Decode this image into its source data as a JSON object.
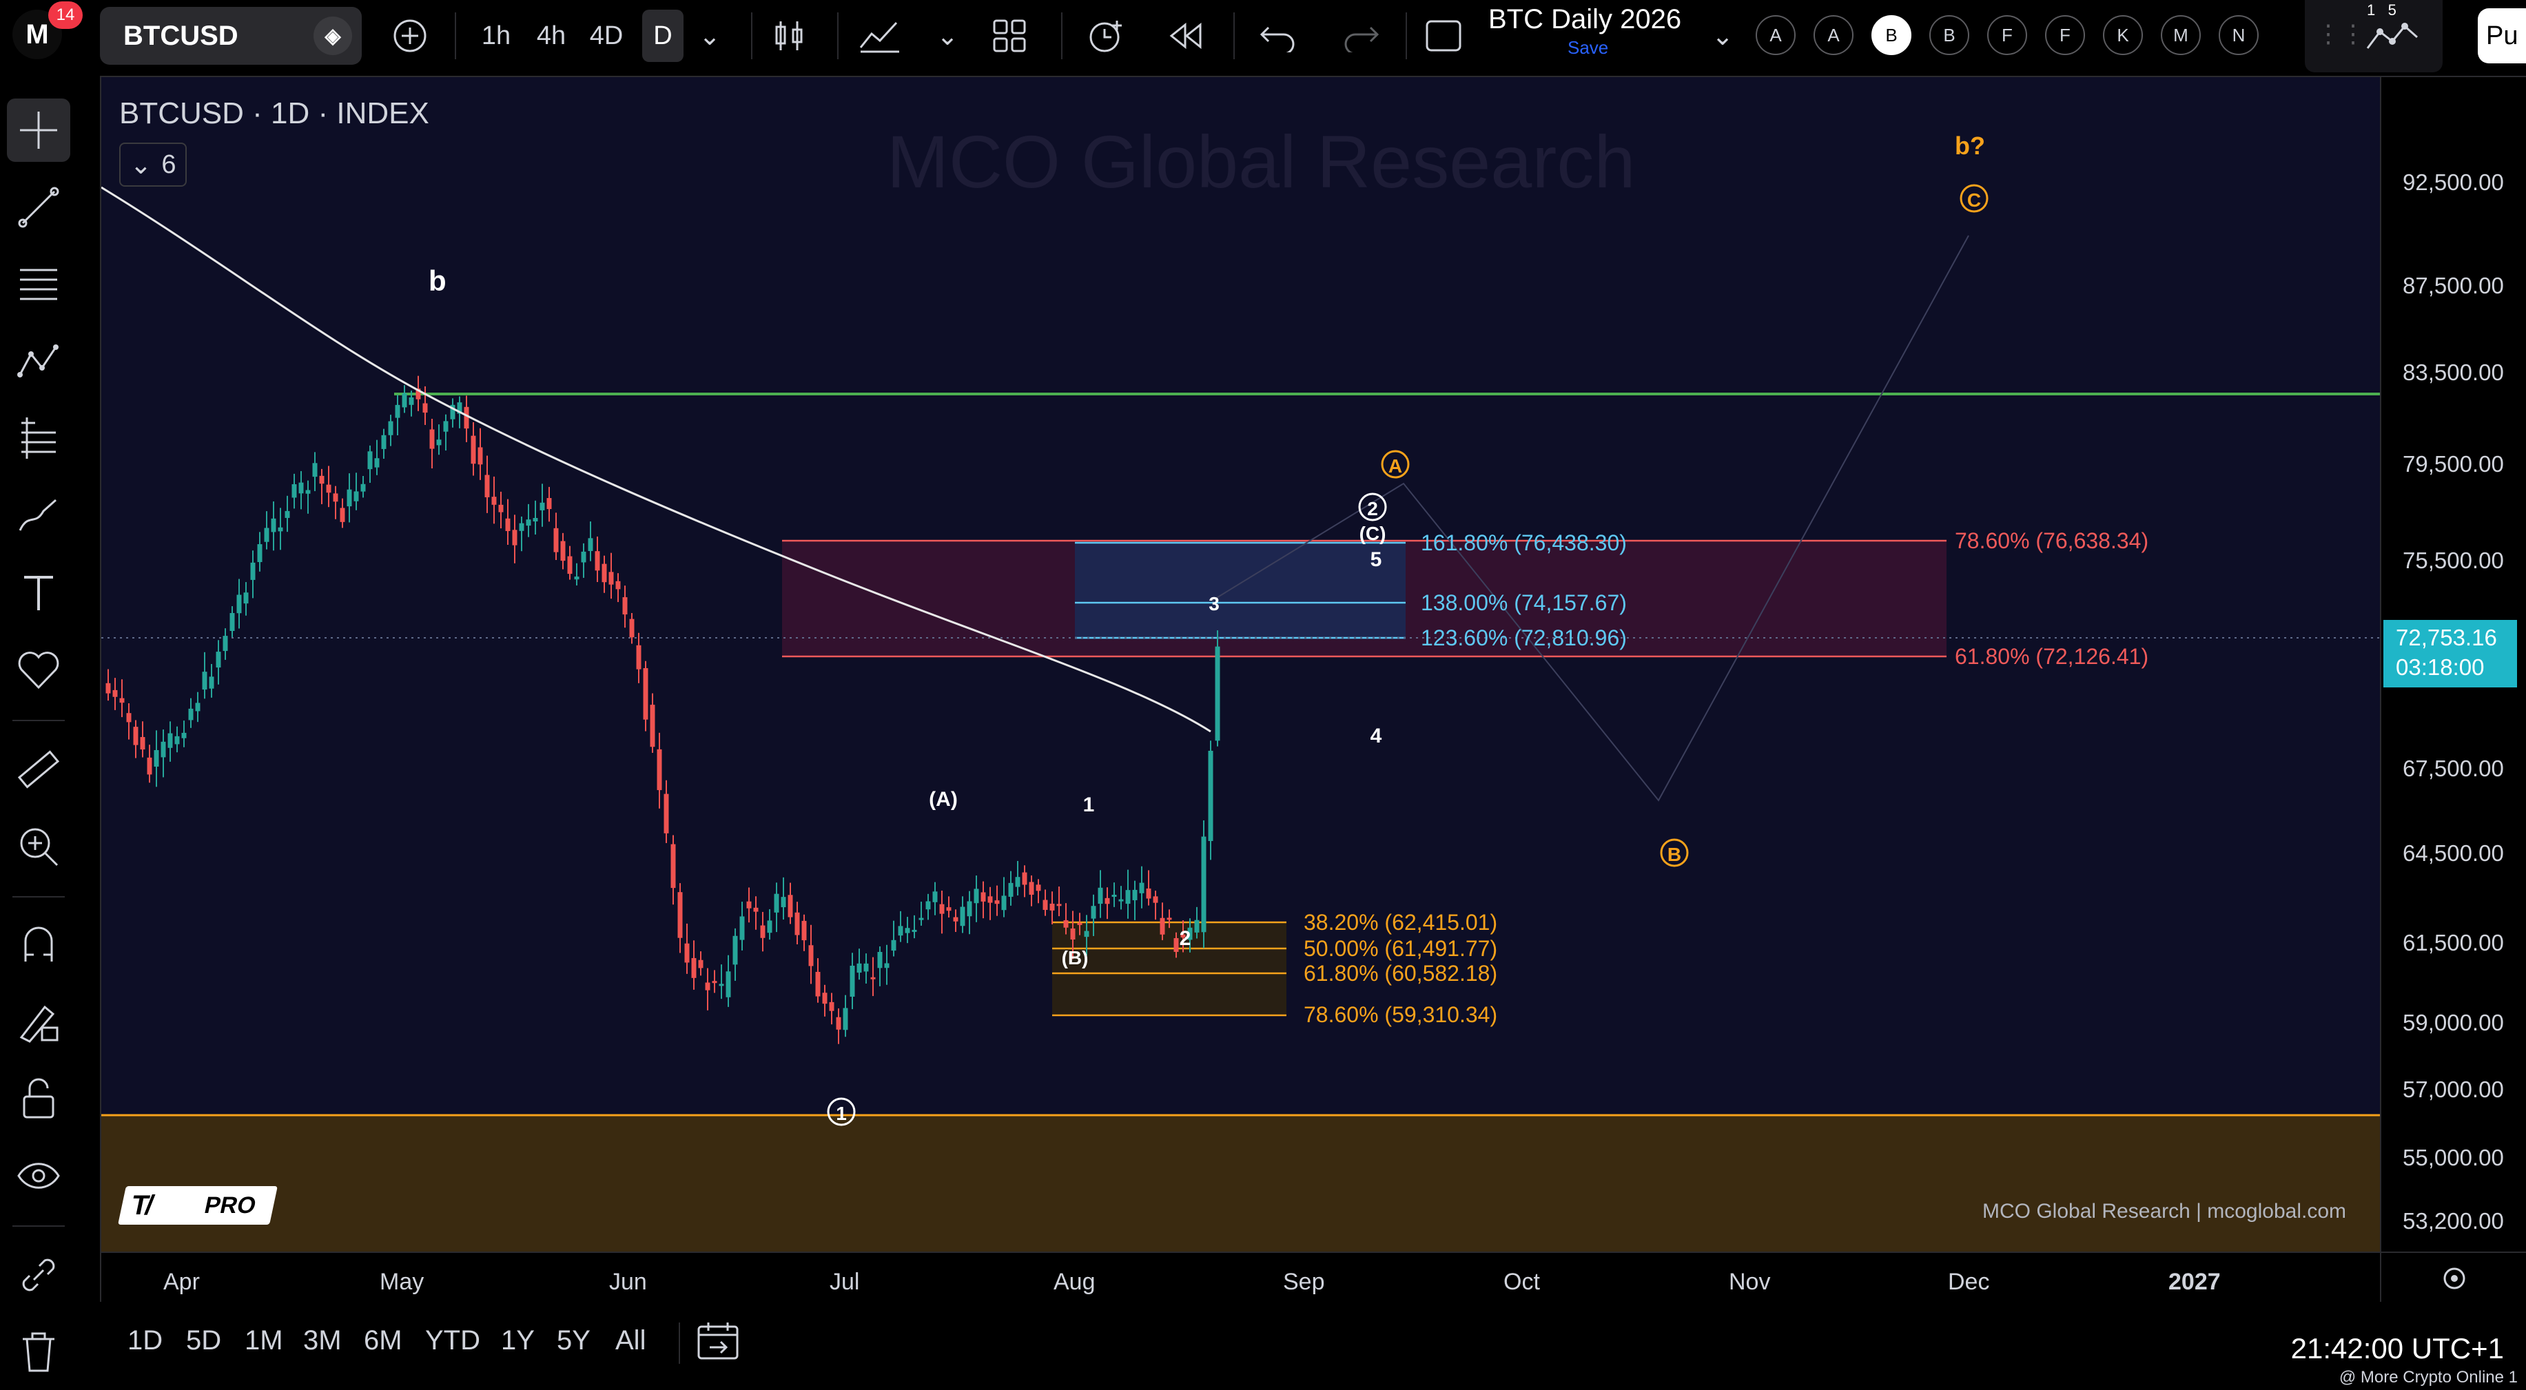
{
  "toolbar": {
    "notification_count": "14",
    "symbol": "BTCUSD",
    "intervals": [
      "1h",
      "4h",
      "4D",
      "D"
    ],
    "active_interval": "D",
    "layout_name": "BTC Daily 2026",
    "layout_save": "Save",
    "alert_buttons": [
      "A",
      "A",
      "B",
      "B",
      "F",
      "F",
      "K",
      "M",
      "N"
    ],
    "active_alert_button": "B",
    "profile_partial": "Pu",
    "right_badge_top": "1   5"
  },
  "chart": {
    "pane_title": "BTCUSD · 1D · INDEX",
    "indicator_count": "6",
    "watermark": "MCO Global Research",
    "footer_credit": "MCO Global Research | mcoglobal.com",
    "tv_badge": "PRO",
    "price_axis": {
      "ticks": [
        "92,500.00",
        "87,500.00",
        "83,500.00",
        "79,500.00",
        "75,500.00",
        "67,500.00",
        "64,500.00",
        "61,500.00",
        "59,000.00",
        "57,000.00",
        "55,000.00",
        "53,200.00"
      ],
      "last_price": "72,753.16",
      "countdown": "03:18:00"
    },
    "time_axis": [
      "Apr",
      "May",
      "Jun",
      "Jul",
      "Aug",
      "Sep",
      "Oct",
      "Nov",
      "Dec",
      "2027"
    ],
    "wave_labels": {
      "b_top": "b",
      "b_question": "b?",
      "c_circle": "C",
      "a_circle": "A",
      "b_circle": "B",
      "two_circle": "2",
      "c_paren": "(C)",
      "five": "5",
      "three": "3",
      "four": "4",
      "one": "1",
      "two": "2",
      "a_paren": "(A)",
      "b_paren": "(B)",
      "one_circle": "1"
    },
    "fib_upper_extension": [
      {
        "label": "161.80% (76,438.30)",
        "color": "#5ec8f2"
      },
      {
        "label": "138.00% (74,157.67)",
        "color": "#5ec8f2"
      },
      {
        "label": "123.60% (72,810.96)",
        "color": "#5ec8f2"
      }
    ],
    "fib_red_retracement": [
      {
        "label": "78.60% (76,638.34)",
        "color": "#f05a5a"
      },
      {
        "label": "61.80% (72,126.41)",
        "color": "#f05a5a"
      }
    ],
    "fib_lower_retracement": [
      {
        "label": "38.20% (62,415.01)",
        "color": "#f7a21b"
      },
      {
        "label": "50.00% (61,491.77)",
        "color": "#f7a21b"
      },
      {
        "label": "61.80% (60,582.18)",
        "color": "#f7a21b"
      },
      {
        "label": "78.60% (59,310.34)",
        "color": "#f7a21b"
      }
    ],
    "colors": {
      "background": "#0d0e26",
      "up_candle": "#26a69a",
      "down_candle": "#ef5350",
      "green_line": "#4caf50",
      "orange_zone": "#f7a21b",
      "ma_line": "#ffffff",
      "last_price_label": "#1fb6c8"
    }
  },
  "bottom": {
    "ranges": [
      "1D",
      "5D",
      "1M",
      "3M",
      "6M",
      "YTD",
      "1Y",
      "5Y",
      "All"
    ],
    "clock": "21:42:00 UTC+1",
    "credit": "@ More Crypto Online 1"
  }
}
